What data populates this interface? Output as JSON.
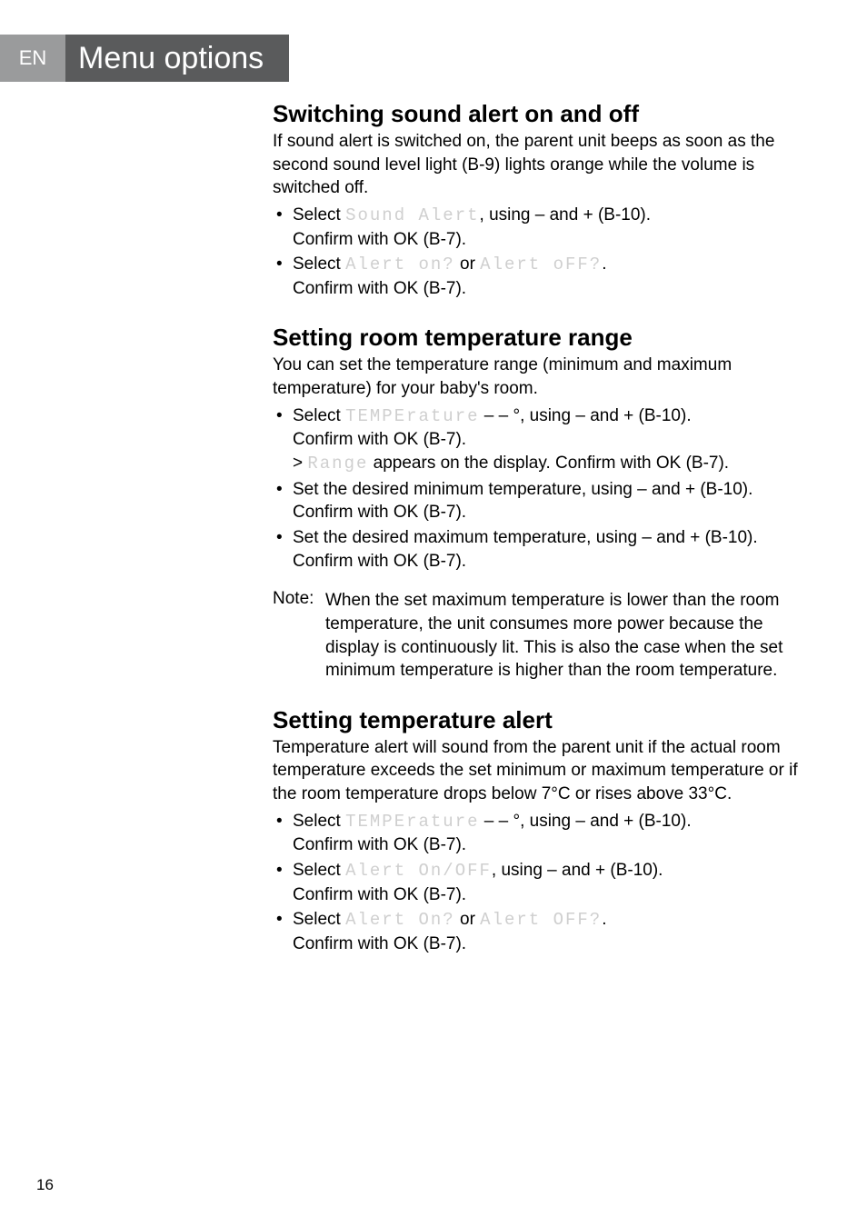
{
  "lang": "EN",
  "pageTitle": "Menu options",
  "pageNumber": "16",
  "s1": {
    "h": "Switching sound alert on and off",
    "p": "If sound alert is switched on, the parent unit beeps as soon as the second sound level light (B-9) lights orange while the volume is switched off.",
    "li1a": "Select ",
    "li1seg": "Sound Alert",
    "li1b": ", using – and + (B-10).",
    "li1c": "Confirm with OK (B-7).",
    "li2a": "Select ",
    "li2seg1": "Alert on?",
    "li2mid": " or ",
    "li2seg2": "Alert oFF?",
    "li2b": ".",
    "li2c": "Confirm with OK (B-7)."
  },
  "s2": {
    "h": "Setting room temperature range",
    "p": "You can set the temperature range (minimum and maximum temperature) for your baby's room.",
    "li1a": "Select ",
    "li1seg": "TEMPErature",
    "li1b": " – – °, using – and + (B-10).",
    "li1c": "Confirm with OK (B-7).",
    "li1d_pre": "> ",
    "li1d_seg": "Range",
    "li1d_post": " appears on the display. Confirm with OK (B-7).",
    "li2a": "Set the desired minimum temperature, using – and + (B-10).",
    "li2b": "Confirm with OK (B-7).",
    "li3a": "Set the desired maximum temperature, using – and + (B-10).",
    "li3b": "Confirm with OK (B-7).",
    "noteLabel": "Note:",
    "noteBody": "When the set maximum temperature is lower than the room temperature, the unit consumes more power because the display is continuously lit. This is also the case when the set minimum temperature is higher than the room temperature."
  },
  "s3": {
    "h": "Setting temperature alert",
    "p": "Temperature alert will sound from the parent unit if the actual room temperature exceeds the set minimum or maximum temperature or if the room temperature drops below 7°C or rises above 33°C.",
    "li1a": "Select ",
    "li1seg": "TEMPErature",
    "li1b": " – – °, using – and + (B-10).",
    "li1c": "Confirm with OK (B-7).",
    "li2a": "Select ",
    "li2seg": "Alert On/OFF",
    "li2b": ", using – and + (B-10).",
    "li2c": "Confirm with OK (B-7).",
    "li3a": "Select ",
    "li3seg1": "Alert On?",
    "li3mid": " or ",
    "li3seg2": "Alert OFF?",
    "li3b": ".",
    "li3c": "Confirm with OK (B-7)."
  }
}
